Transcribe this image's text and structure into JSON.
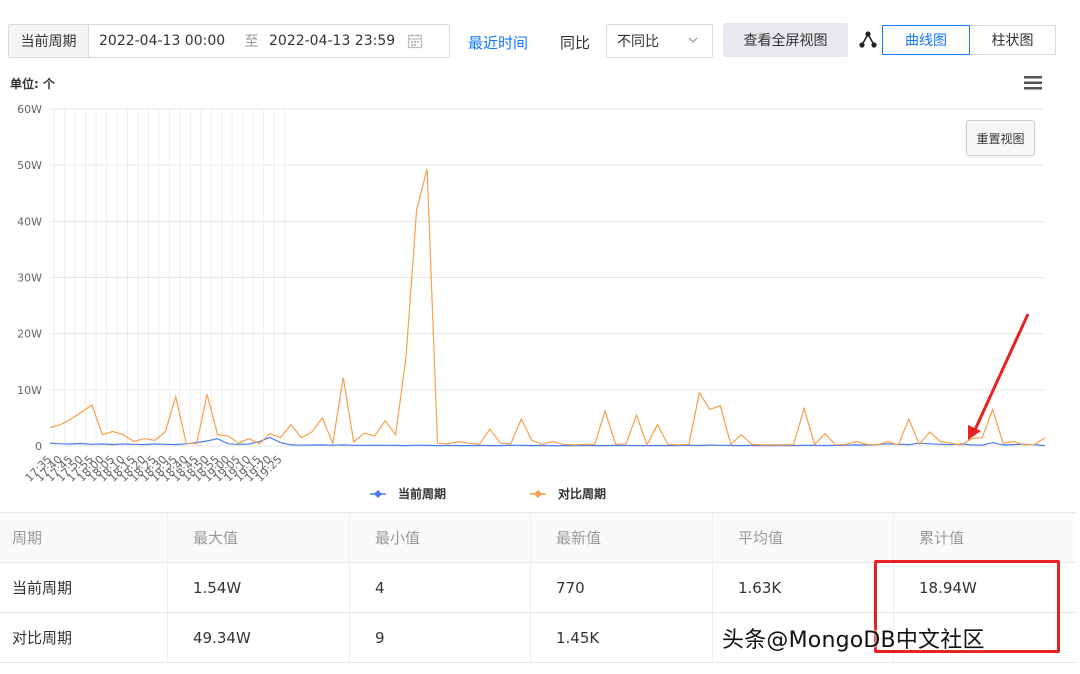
{
  "toolbar": {
    "period_label": "当前周期",
    "date_start": "2022-04-13 00:00",
    "to_label": "至",
    "date_end": "2022-04-13 23:59",
    "recent_link": "最近时间",
    "yoy_label": "同比",
    "yoy_value": "不同比",
    "fullscreen_button": "查看全屏视图",
    "curve_button": "曲线图",
    "bar_button": "柱状图"
  },
  "chart_header": {
    "unit": "单位: 个",
    "reset_button": "重置视图"
  },
  "chart_data": {
    "type": "line",
    "ylim": [
      0,
      600000
    ],
    "y_ticks": [
      "0",
      "10W",
      "20W",
      "30W",
      "40W",
      "50W",
      "60W"
    ],
    "x_tick_labels": [
      "17:35",
      "17:40",
      "17:45",
      "17:50",
      "17:55",
      "18:00",
      "18:05",
      "18:10",
      "18:15",
      "18:20",
      "18:25",
      "18:30",
      "18:35",
      "18:40",
      "18:45",
      "18:50",
      "18:55",
      "19:00",
      "19:05",
      "19:10",
      "19:15",
      "19:20",
      "19:25"
    ],
    "x_start_minute": 1053,
    "x_end_minute": 1528,
    "step_minutes": 5,
    "grid": true,
    "legend_position": "bottom",
    "series": [
      {
        "name": "当前周期",
        "color": "#4a7cf0",
        "points": [
          [
            1053,
            5000
          ],
          [
            1058,
            4000
          ],
          [
            1063,
            3500
          ],
          [
            1068,
            4500
          ],
          [
            1073,
            3000
          ],
          [
            1078,
            3500
          ],
          [
            1083,
            2500
          ],
          [
            1088,
            3500
          ],
          [
            1093,
            3000
          ],
          [
            1098,
            2500
          ],
          [
            1103,
            3500
          ],
          [
            1108,
            3000
          ],
          [
            1113,
            2500
          ],
          [
            1118,
            4000
          ],
          [
            1123,
            6000
          ],
          [
            1128,
            9000
          ],
          [
            1133,
            13000
          ],
          [
            1138,
            4000
          ],
          [
            1143,
            3000
          ],
          [
            1148,
            3500
          ],
          [
            1153,
            8000
          ],
          [
            1158,
            15400
          ],
          [
            1163,
            6000
          ],
          [
            1168,
            2000
          ],
          [
            1173,
            1500
          ],
          [
            1178,
            1800
          ],
          [
            1183,
            2000
          ],
          [
            1188,
            1500
          ],
          [
            1193,
            2000
          ],
          [
            1198,
            1200
          ],
          [
            1203,
            1000
          ],
          [
            1208,
            1500
          ],
          [
            1213,
            1200
          ],
          [
            1218,
            1000
          ],
          [
            1223,
            800
          ],
          [
            1228,
            1500
          ],
          [
            1233,
            1000
          ],
          [
            1238,
            800
          ],
          [
            1243,
            900
          ],
          [
            1248,
            700
          ],
          [
            1253,
            800
          ],
          [
            1258,
            1000
          ],
          [
            1263,
            800
          ],
          [
            1268,
            700
          ],
          [
            1273,
            1500
          ],
          [
            1278,
            1000
          ],
          [
            1283,
            800
          ],
          [
            1288,
            900
          ],
          [
            1293,
            800
          ],
          [
            1298,
            700
          ],
          [
            1303,
            800
          ],
          [
            1308,
            900
          ],
          [
            1313,
            800
          ],
          [
            1318,
            700
          ],
          [
            1323,
            1000
          ],
          [
            1328,
            900
          ],
          [
            1333,
            700
          ],
          [
            1338,
            800
          ],
          [
            1343,
            900
          ],
          [
            1348,
            700
          ],
          [
            1353,
            800
          ],
          [
            1358,
            1200
          ],
          [
            1363,
            900
          ],
          [
            1368,
            1800
          ],
          [
            1373,
            1200
          ],
          [
            1378,
            1000
          ],
          [
            1383,
            800
          ],
          [
            1388,
            1000
          ],
          [
            1393,
            800
          ],
          [
            1398,
            900
          ],
          [
            1403,
            1000
          ],
          [
            1408,
            800
          ],
          [
            1413,
            1200
          ],
          [
            1418,
            1000
          ],
          [
            1423,
            900
          ],
          [
            1428,
            1000
          ],
          [
            1433,
            1500
          ],
          [
            1438,
            2000
          ],
          [
            1443,
            1800
          ],
          [
            1448,
            2500
          ],
          [
            1453,
            4000
          ],
          [
            1458,
            3000
          ],
          [
            1463,
            2500
          ],
          [
            1468,
            5000
          ],
          [
            1473,
            4000
          ],
          [
            1478,
            3000
          ],
          [
            1483,
            2500
          ],
          [
            1488,
            3500
          ],
          [
            1493,
            2000
          ],
          [
            1498,
            1500
          ],
          [
            1503,
            6000
          ],
          [
            1508,
            2000
          ],
          [
            1513,
            2500
          ],
          [
            1518,
            3000
          ],
          [
            1523,
            2500
          ],
          [
            1528,
            770
          ]
        ]
      },
      {
        "name": "对比周期",
        "color": "#f5a04a",
        "points": [
          [
            1053,
            33000
          ],
          [
            1058,
            38000
          ],
          [
            1063,
            48000
          ],
          [
            1068,
            60000
          ],
          [
            1073,
            73000
          ],
          [
            1078,
            20000
          ],
          [
            1083,
            26000
          ],
          [
            1088,
            20000
          ],
          [
            1093,
            8000
          ],
          [
            1098,
            13000
          ],
          [
            1103,
            10000
          ],
          [
            1108,
            25000
          ],
          [
            1113,
            88000
          ],
          [
            1118,
            5000
          ],
          [
            1123,
            4000
          ],
          [
            1128,
            92000
          ],
          [
            1133,
            20000
          ],
          [
            1138,
            18000
          ],
          [
            1143,
            5000
          ],
          [
            1148,
            13000
          ],
          [
            1153,
            4000
          ],
          [
            1158,
            22000
          ],
          [
            1163,
            15000
          ],
          [
            1168,
            38000
          ],
          [
            1173,
            15000
          ],
          [
            1178,
            25000
          ],
          [
            1183,
            50000
          ],
          [
            1188,
            5000
          ],
          [
            1193,
            122000
          ],
          [
            1198,
            7000
          ],
          [
            1203,
            23000
          ],
          [
            1208,
            18000
          ],
          [
            1213,
            45000
          ],
          [
            1218,
            20000
          ],
          [
            1223,
            160000
          ],
          [
            1228,
            420000
          ],
          [
            1233,
            493400
          ],
          [
            1238,
            5000
          ],
          [
            1243,
            4000
          ],
          [
            1248,
            8000
          ],
          [
            1253,
            5000
          ],
          [
            1258,
            3000
          ],
          [
            1263,
            30000
          ],
          [
            1268,
            5000
          ],
          [
            1273,
            4000
          ],
          [
            1278,
            48000
          ],
          [
            1283,
            10000
          ],
          [
            1288,
            3000
          ],
          [
            1293,
            8000
          ],
          [
            1298,
            3000
          ],
          [
            1303,
            2000
          ],
          [
            1308,
            3000
          ],
          [
            1313,
            3000
          ],
          [
            1318,
            62000
          ],
          [
            1323,
            3000
          ],
          [
            1328,
            4000
          ],
          [
            1333,
            55000
          ],
          [
            1338,
            2000
          ],
          [
            1343,
            38000
          ],
          [
            1348,
            3000
          ],
          [
            1353,
            2000
          ],
          [
            1358,
            3000
          ],
          [
            1363,
            95000
          ],
          [
            1368,
            65000
          ],
          [
            1373,
            72000
          ],
          [
            1378,
            3000
          ],
          [
            1383,
            20000
          ],
          [
            1388,
            3000
          ],
          [
            1393,
            2000
          ],
          [
            1398,
            2000
          ],
          [
            1403,
            2000
          ],
          [
            1408,
            2500
          ],
          [
            1413,
            67000
          ],
          [
            1418,
            3000
          ],
          [
            1423,
            22000
          ],
          [
            1428,
            2000
          ],
          [
            1433,
            3000
          ],
          [
            1438,
            8000
          ],
          [
            1443,
            3000
          ],
          [
            1448,
            2000
          ],
          [
            1453,
            8000
          ],
          [
            1458,
            2000
          ],
          [
            1463,
            48000
          ],
          [
            1468,
            3000
          ],
          [
            1473,
            25000
          ],
          [
            1478,
            8000
          ],
          [
            1483,
            5000
          ],
          [
            1488,
            2000
          ],
          [
            1493,
            13000
          ],
          [
            1498,
            15000
          ],
          [
            1503,
            65000
          ],
          [
            1508,
            5000
          ],
          [
            1513,
            8000
          ],
          [
            1518,
            2000
          ],
          [
            1523,
            3000
          ],
          [
            1528,
            14500
          ]
        ]
      }
    ]
  },
  "table": {
    "headers": [
      "周期",
      "最大值",
      "最小值",
      "最新值",
      "平均值",
      "累计值"
    ],
    "rows": [
      [
        "当前周期",
        "1.54W",
        "4",
        "770",
        "1.63K",
        "18.94W"
      ],
      [
        "对比周期",
        "49.34W",
        "9",
        "1.45K",
        "",
        ""
      ]
    ]
  },
  "watermark": "头条@MongoDB中文社区",
  "colors": {
    "accent": "#1677ff",
    "annotation": "#e62222"
  }
}
